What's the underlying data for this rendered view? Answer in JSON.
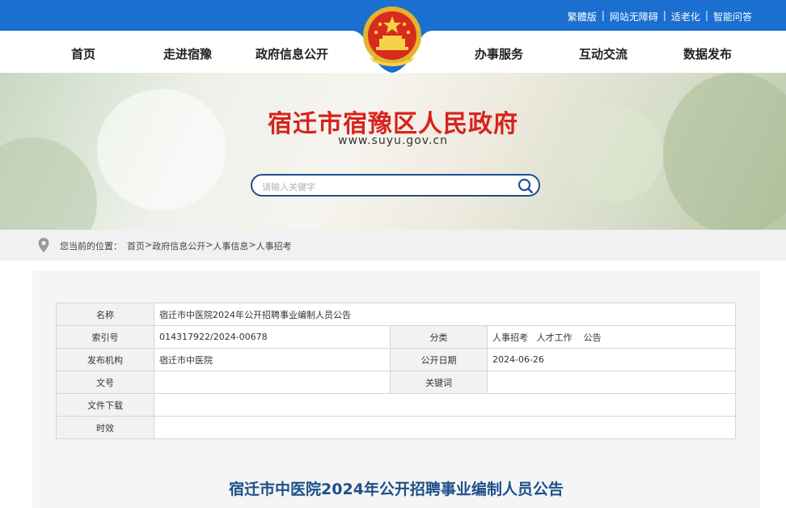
{
  "top_links": [
    "繁體版",
    "网站无障碍",
    "适老化",
    "智能问答"
  ],
  "top_separator": "|",
  "nav": {
    "items": [
      "首页",
      "走进宿豫",
      "政府信息公开",
      "办事服务",
      "互动交流",
      "数据发布"
    ]
  },
  "banner": {
    "title": "宿迁市宿豫区人民政府",
    "url": "www.suyu.gov.cn"
  },
  "search": {
    "placeholder": "请输入关键字",
    "value": ""
  },
  "breadcrumb": {
    "prefix": "您当前的位置：",
    "items": [
      "首页",
      "政府信息公开",
      "人事信息",
      "人事招考"
    ],
    "separator": ">"
  },
  "meta": {
    "name_label": "名称",
    "name_value": "宿迁市中医院2024年公开招聘事业编制人员公告",
    "index_label": "索引号",
    "index_value": "014317922/2024-00678",
    "category_label": "分类",
    "category_value": "人事招考   人才工作    公告",
    "publisher_label": "发布机构",
    "publisher_value": "宿迁市中医院",
    "date_label": "公开日期",
    "date_value": "2024-06-26",
    "docno_label": "文号",
    "docno_value": "",
    "keywords_label": "关键词",
    "keywords_value": "",
    "download_label": "文件下载",
    "download_value": "",
    "validity_label": "时效",
    "validity_value": ""
  },
  "doc_title": "宿迁市中医院2024年公开招聘事业编制人员公告",
  "colors": {
    "topbar": "#1a6fd0",
    "title_red": "#d9221c",
    "doc_title_blue": "#1d4f8a",
    "search_border": "#1f4f8f"
  }
}
